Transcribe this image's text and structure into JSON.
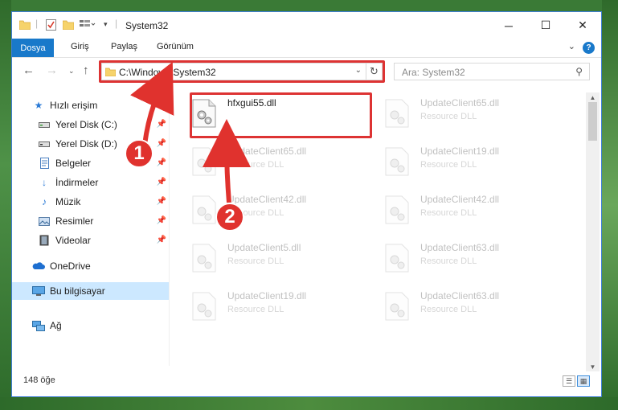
{
  "window": {
    "title": "System32",
    "ribbon_tabs": [
      "Dosya",
      "Giriş",
      "Paylaş",
      "Görünüm"
    ]
  },
  "address": {
    "path": "C:\\Windows\\System32"
  },
  "search": {
    "placeholder": "Ara: System32"
  },
  "sidebar": {
    "items": [
      {
        "label": "Hızlı erişim",
        "icon": "star-icon"
      },
      {
        "label": "Yerel Disk (C:)",
        "icon": "drive-icon",
        "pinned": true
      },
      {
        "label": "Yerel Disk (D:)",
        "icon": "drive-icon",
        "pinned": true
      },
      {
        "label": "Belgeler",
        "icon": "document-icon",
        "pinned": true
      },
      {
        "label": "İndirmeler",
        "icon": "download-icon",
        "pinned": true
      },
      {
        "label": "Müzik",
        "icon": "music-icon",
        "pinned": true
      },
      {
        "label": "Resimler",
        "icon": "pictures-icon",
        "pinned": true
      },
      {
        "label": "Videolar",
        "icon": "video-icon",
        "pinned": true
      },
      {
        "label": "OneDrive",
        "icon": "cloud-icon"
      },
      {
        "label": "Bu bilgisayar",
        "icon": "computer-icon",
        "selected": true
      },
      {
        "label": "Ağ",
        "icon": "network-icon"
      }
    ]
  },
  "files": [
    {
      "name": "hfxgui55.dll",
      "type": "",
      "highlighted": true
    },
    {
      "name": "UpdateClient65.dll",
      "type": "Resource DLL"
    },
    {
      "name": "UpdateClient65.dll",
      "type": "Resource DLL"
    },
    {
      "name": "UpdateClient19.dll",
      "type": "Resource DLL"
    },
    {
      "name": "UpdateClient42.dll",
      "type": "Resource DLL"
    },
    {
      "name": "UpdateClient42.dll",
      "type": "Resource DLL"
    },
    {
      "name": "UpdateClient5.dll",
      "type": "Resource DLL"
    },
    {
      "name": "UpdateClient63.dll",
      "type": "Resource DLL"
    },
    {
      "name": "UpdateClient19.dll",
      "type": "Resource DLL"
    },
    {
      "name": "UpdateClient63.dll",
      "type": "Resource DLL"
    }
  ],
  "status": {
    "item_count": "148 öğe"
  },
  "annotations": {
    "step1": "1",
    "step2": "2"
  },
  "colors": {
    "accent": "#1979ca",
    "highlight_box": "#dd3333",
    "selection": "#cce8ff"
  }
}
